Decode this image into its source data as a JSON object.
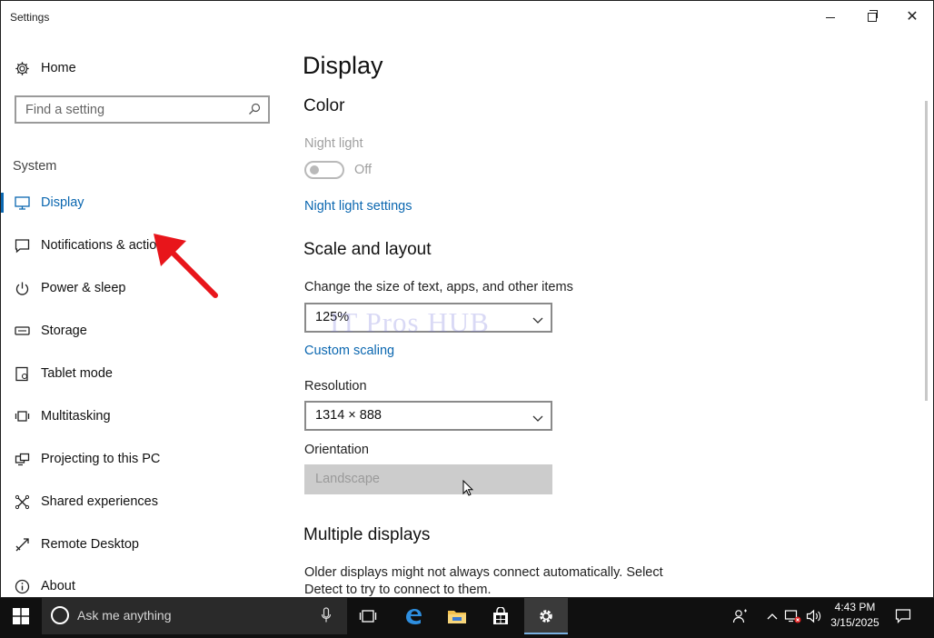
{
  "window": {
    "title": "Settings",
    "controls": {
      "minimize": "minimize-icon",
      "maximize": "restore-icon",
      "close": "close-icon"
    }
  },
  "sidebar": {
    "home_label": "Home",
    "search_placeholder": "Find a setting",
    "section_heading": "System",
    "items": [
      {
        "label": "Display",
        "icon": "monitor-icon",
        "active": true
      },
      {
        "label": "Notifications & actions",
        "icon": "notification-icon"
      },
      {
        "label": "Power & sleep",
        "icon": "power-icon"
      },
      {
        "label": "Storage",
        "icon": "storage-icon"
      },
      {
        "label": "Tablet mode",
        "icon": "tablet-icon"
      },
      {
        "label": "Multitasking",
        "icon": "multitasking-icon"
      },
      {
        "label": "Projecting to this PC",
        "icon": "projecting-icon"
      },
      {
        "label": "Shared experiences",
        "icon": "shared-icon"
      },
      {
        "label": "Remote Desktop",
        "icon": "remote-desktop-icon"
      },
      {
        "label": "About",
        "icon": "info-icon"
      }
    ]
  },
  "main": {
    "page_title": "Display",
    "color_heading": "Color",
    "night_light_label": "Night light",
    "night_light_state": "Off",
    "night_light_on": false,
    "night_light_settings_link": "Night light settings",
    "scale_heading": "Scale and layout",
    "scale_label": "Change the size of text, apps, and other items",
    "scale_value": "125%",
    "custom_scaling_link": "Custom scaling",
    "resolution_label": "Resolution",
    "resolution_value": "1314 × 888",
    "orientation_label": "Orientation",
    "orientation_value": "Landscape",
    "multiple_displays_heading": "Multiple displays",
    "multiple_displays_text_line1": "Older displays might not always connect automatically. Select",
    "multiple_displays_text_line2": "Detect to try to connect to them."
  },
  "watermark": "IT Pros HUB",
  "annotation": {
    "arrow_color": "#e8151b"
  },
  "taskbar": {
    "search_placeholder": "Ask me anything",
    "clock_time": "4:43 PM",
    "clock_date": "3/15/2025"
  },
  "colors": {
    "accent": "#0b67b0",
    "taskbar": "#101010",
    "disabled": "#a0a0a0"
  }
}
